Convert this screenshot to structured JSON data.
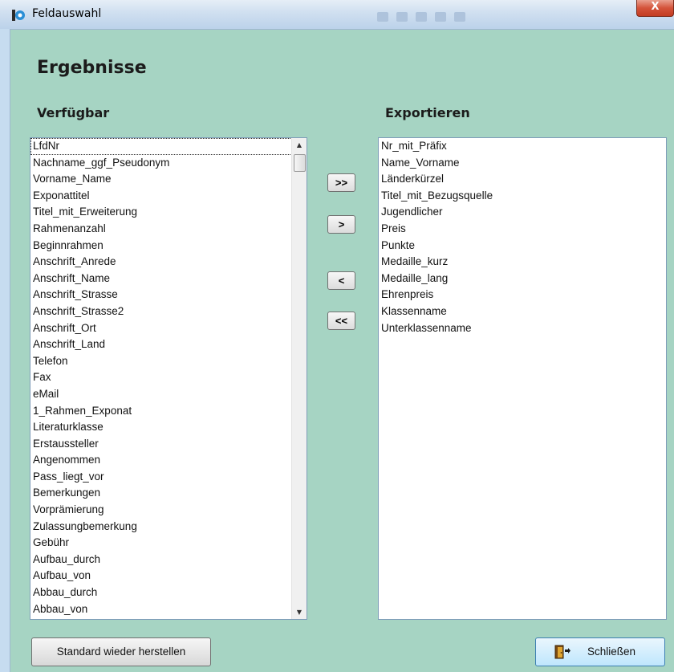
{
  "window": {
    "title": "Feldauswahl",
    "close_symbol": "X"
  },
  "heading": "Ergebnisse",
  "available": {
    "label": "Verfügbar",
    "items": [
      "LfdNr",
      "Nachname_ggf_Pseudonym",
      "Vorname_Name",
      "Exponattitel",
      "Titel_mit_Erweiterung",
      "Rahmenanzahl",
      "Beginnrahmen",
      "Anschrift_Anrede",
      "Anschrift_Name",
      "Anschrift_Strasse",
      "Anschrift_Strasse2",
      "Anschrift_Ort",
      "Anschrift_Land",
      "Telefon",
      "Fax",
      "eMail",
      "1_Rahmen_Exponat",
      "Literaturklasse",
      "Erstaussteller",
      "Angenommen",
      "Pass_liegt_vor",
      "Bemerkungen",
      "Vorprämierung",
      "Zulassungbemerkung",
      "Gebühr",
      "Aufbau_durch",
      "Aufbau_von",
      "Abbau_durch",
      "Abbau_von"
    ]
  },
  "export": {
    "label": "Exportieren",
    "items": [
      "Nr_mit_Präfix",
      "Name_Vorname",
      "Länderkürzel",
      "Titel_mit_Bezugsquelle",
      "Jugendlicher",
      "Preis",
      "Punkte",
      "Medaille_kurz",
      "Medaille_lang",
      "Ehrenpreis",
      "Klassenname",
      "Unterklassenname"
    ]
  },
  "buttons": {
    "add_all": ">>",
    "add_one": ">",
    "remove_one": "<",
    "remove_all": "<<",
    "restore": "Standard wieder herstellen",
    "close": "Schließen"
  },
  "icons": {
    "app": "app-icon",
    "close": "close-icon",
    "door": "door-exit-icon"
  }
}
